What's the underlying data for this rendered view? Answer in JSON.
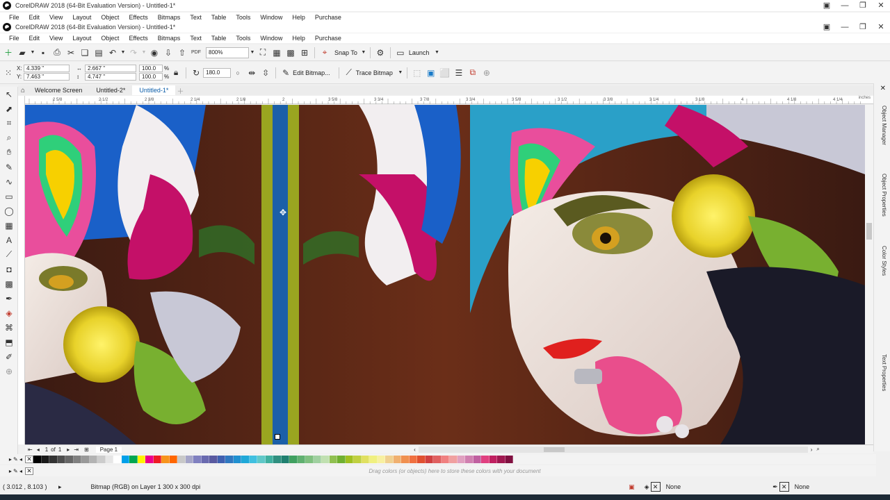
{
  "outer_window": {
    "title": "CorelDRAW 2018 (64-Bit Evaluation Version) - Untitled-1*",
    "menu": [
      "File",
      "Edit",
      "View",
      "Layout",
      "Object",
      "Effects",
      "Bitmaps",
      "Text",
      "Table",
      "Tools",
      "Window",
      "Help",
      "Purchase"
    ]
  },
  "inner_window": {
    "title": "CorelDRAW 2018 (64-Bit Evaluation Version) - Untitled-1*",
    "menu": [
      "File",
      "Edit",
      "View",
      "Layout",
      "Object",
      "Effects",
      "Bitmaps",
      "Text",
      "Table",
      "Tools",
      "Window",
      "Help",
      "Purchase"
    ]
  },
  "standard_toolbar": {
    "zoom_value": "800%",
    "snap_label": "Snap To",
    "launch_label": "Launch"
  },
  "property_bar": {
    "x": "4.339 \"",
    "y": "7.463 \"",
    "width": "2.667 \"",
    "height": "4.747 \"",
    "scale_w": "100.0",
    "scale_h": "100.0",
    "percent": "%",
    "rotation": "180.0",
    "edit_bitmap": "Edit Bitmap...",
    "trace_bitmap": "Trace Bitmap"
  },
  "tabs": [
    {
      "label": "Welcome Screen"
    },
    {
      "label": "Untitled-2*"
    },
    {
      "label": "Untitled-1*"
    }
  ],
  "ruler": {
    "units": "inches",
    "labels": [
      "2 5/8",
      "2 1/2",
      "2 3/8",
      "2 1/4",
      "2 1/8",
      "2",
      "3 5/8",
      "3 3/4",
      "3 7/8",
      "3 3/4",
      "3 5/8",
      "3 1/2",
      "3 3/8",
      "3 1/4",
      "3 1/8",
      "4",
      "4 1/8",
      "4 1/4"
    ]
  },
  "right_dock": [
    "Object Manager",
    "Object Properties",
    "Color Styles",
    "Text Properties"
  ],
  "page_nav": {
    "current": "1",
    "of": "of",
    "total": "1",
    "page_label": "Page 1"
  },
  "document_palette_hint": "Drag colors (or objects) here to store these colors with your document",
  "status": {
    "coords": "( 3.012 , 8.103 )",
    "object_info": "Bitmap (RGB) on Layer 1 300 x 300 dpi",
    "fill_label": "None",
    "outline_label": "None"
  },
  "palette_colors": [
    "#000000",
    "#1a1a1a",
    "#333333",
    "#4d4d4d",
    "#666666",
    "#808080",
    "#999999",
    "#b3b3b3",
    "#cccccc",
    "#e6e6e6",
    "#ffffff",
    "#00a0e9",
    "#00a651",
    "#fff200",
    "#ec008c",
    "#ed1c24",
    "#f7941d",
    "#ff6600",
    "#c8c8c8",
    "#a5a5c8",
    "#8080c0",
    "#6a6aaf",
    "#5a5aa0",
    "#4060b0",
    "#3078c0",
    "#2090d0",
    "#20a8d8",
    "#40c0e0",
    "#60c8c8",
    "#40b0a0",
    "#309080",
    "#208070",
    "#40a060",
    "#60b070",
    "#80c080",
    "#a0d0a0",
    "#c0e0b0",
    "#90c050",
    "#70b030",
    "#a0c020",
    "#c0d040",
    "#e0e060",
    "#f0f080",
    "#f8f0a0",
    "#f0d090",
    "#f0b070",
    "#f09050",
    "#f07040",
    "#e05030",
    "#d04040",
    "#e06060",
    "#f08080",
    "#f0a0a0",
    "#e0a0c0",
    "#d080b0",
    "#c060a0",
    "#e04080",
    "#c02060",
    "#a01850",
    "#801040"
  ]
}
